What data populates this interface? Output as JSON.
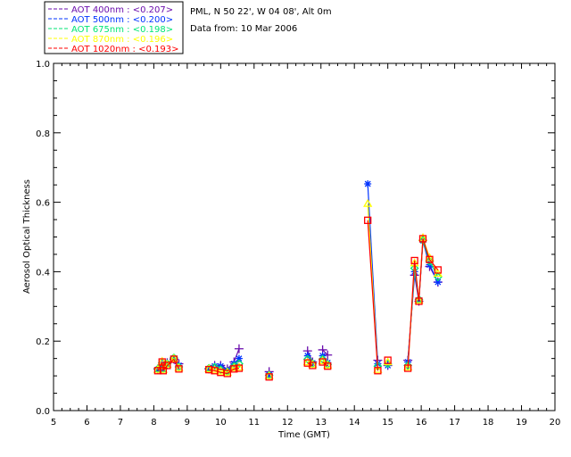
{
  "header": {
    "site": "PML, N 50 22', W 04 08', Alt 0m",
    "date": "Data from: 10 Mar 2006"
  },
  "chart_data": {
    "type": "scatter",
    "title": "",
    "xlabel": "Time (GMT)",
    "ylabel": "Aerosol Optical Thickness",
    "xlim": [
      5,
      20
    ],
    "ylim": [
      0,
      1.0
    ],
    "xticks": [
      "5",
      "6",
      "7",
      "8",
      "9",
      "10",
      "11",
      "12",
      "13",
      "14",
      "15",
      "16",
      "17",
      "18",
      "19",
      "20"
    ],
    "yticks": [
      "0.0",
      "0.2",
      "0.4",
      "0.6",
      "0.8",
      "1.0"
    ],
    "grid": false,
    "legend_placement": "top-left, outside plot",
    "x": [
      8.12,
      8.25,
      8.28,
      8.4,
      8.6,
      8.75,
      9.65,
      9.82,
      10.0,
      10.2,
      10.4,
      10.55,
      11.45,
      12.6,
      12.75,
      13.05,
      13.2,
      14.4,
      14.7,
      15.0,
      15.6,
      15.8,
      15.93,
      16.05,
      16.25,
      16.5
    ],
    "series": [
      {
        "name": "AOT  400nm : <0.207>",
        "color": "#6a0dad",
        "marker": "plus",
        "values": [
          0.12,
          0.13,
          0.122,
          0.138,
          0.148,
          0.135,
          0.12,
          0.13,
          0.13,
          0.12,
          0.14,
          0.178,
          0.112,
          0.172,
          0.14,
          0.175,
          0.16,
          null,
          0.145,
          0.13,
          0.145,
          0.39,
          0.315,
          0.49,
          0.415,
          0.37
        ]
      },
      {
        "name": "AOT  500nm : <0.200>",
        "color": "#0033ff",
        "marker": "asterisk",
        "values": [
          0.118,
          0.135,
          0.12,
          0.135,
          0.15,
          0.13,
          0.12,
          0.128,
          0.128,
          0.115,
          0.135,
          0.15,
          0.103,
          0.158,
          0.137,
          0.158,
          0.138,
          0.653,
          0.135,
          0.13,
          0.14,
          0.4,
          0.318,
          0.49,
          0.42,
          0.37
        ]
      },
      {
        "name": "AOT  675nm : <0.198>",
        "color": "#00e676",
        "marker": "diamond",
        "values": [
          0.12,
          0.138,
          0.12,
          0.135,
          0.152,
          0.126,
          0.122,
          0.125,
          0.118,
          0.112,
          0.128,
          0.135,
          0.102,
          0.148,
          0.135,
          0.148,
          0.133,
          null,
          0.128,
          0.135,
          0.13,
          0.41,
          0.32,
          0.49,
          0.43,
          0.385
        ]
      },
      {
        "name": "AOT  870nm : <0.196>",
        "color": "#ffff00",
        "marker": "triangle",
        "values": [
          0.118,
          0.142,
          0.118,
          0.133,
          0.15,
          0.123,
          0.12,
          0.118,
          0.113,
          0.11,
          0.123,
          0.125,
          0.1,
          0.14,
          0.133,
          0.143,
          0.131,
          0.596,
          0.118,
          0.14,
          0.125,
          0.425,
          0.318,
          0.498,
          0.44,
          0.395
        ]
      },
      {
        "name": "AOT 1020nm : <0.193>",
        "color": "#ff0000",
        "marker": "square",
        "values": [
          0.115,
          0.14,
          0.115,
          0.13,
          0.148,
          0.12,
          0.118,
          0.115,
          0.11,
          0.107,
          0.12,
          0.122,
          0.097,
          0.137,
          0.13,
          0.14,
          0.128,
          0.548,
          0.115,
          0.145,
          0.122,
          0.432,
          0.315,
          0.495,
          0.435,
          0.405
        ]
      }
    ]
  }
}
